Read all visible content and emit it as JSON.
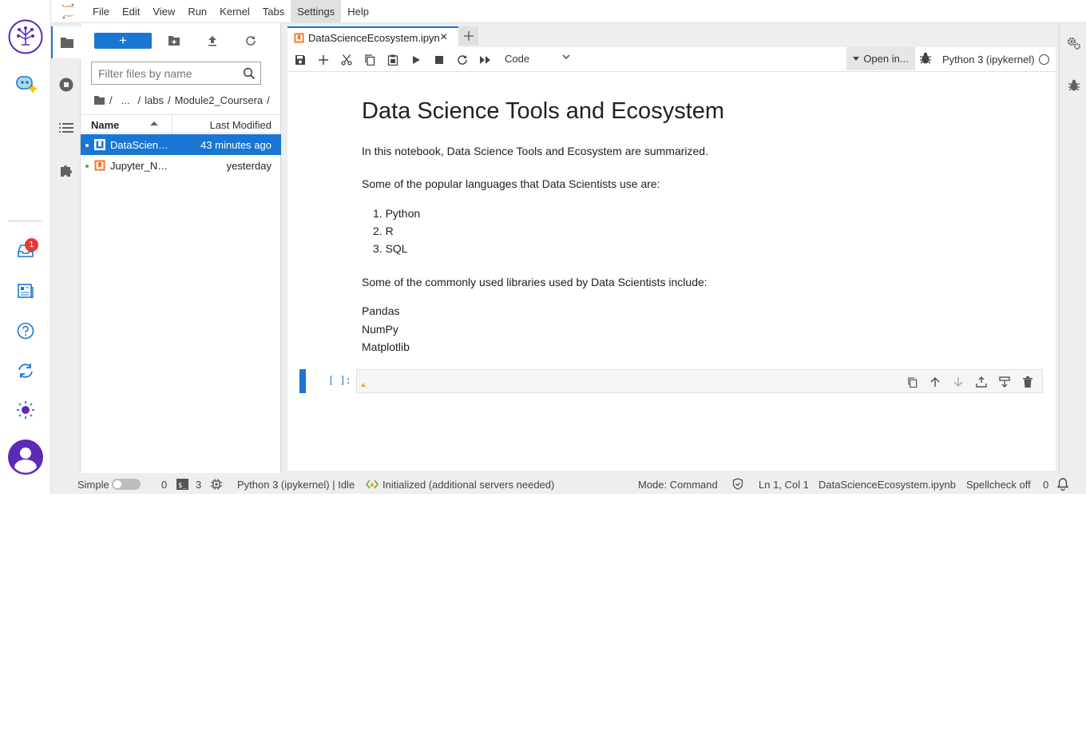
{
  "menubar": {
    "items": [
      "File",
      "Edit",
      "View",
      "Run",
      "Kernel",
      "Tabs",
      "Settings",
      "Help"
    ],
    "active": "Settings"
  },
  "outer_rail": {
    "notification_count": "1",
    "icons": [
      "app-logo-icon",
      "ai-assistant-icon",
      "inbox-icon",
      "document-icon",
      "help-icon",
      "sync-icon",
      "theme-icon",
      "user-avatar-icon"
    ]
  },
  "filebrowser": {
    "filter_placeholder": "Filter files by name",
    "breadcrumb": [
      "/",
      "...",
      "/",
      "labs",
      "/",
      "Module2_Coursera",
      "/"
    ],
    "header": {
      "name": "Name",
      "modified": "Last Modified"
    },
    "files": [
      {
        "name": "DataScienceEcosystem.ipynb",
        "modified": "43 minutes ago",
        "selected": true
      },
      {
        "name": "Jupyter_Notebook.ipynb",
        "modified": "yesterday",
        "selected": false
      }
    ]
  },
  "tab": {
    "label": "DataScienceEcosystem.ipynb",
    "add": "+"
  },
  "toolbar": {
    "cell_type": "Code",
    "open_in": "Open in...",
    "kernel": "Python 3 (ipykernel)"
  },
  "notebook": {
    "title": "Data Science Tools and Ecosystem",
    "intro": "In this notebook, Data Science Tools and Ecosystem are summarized.",
    "languages_intro": "Some of the popular languages that Data Scientists use are:",
    "languages": [
      "1. Python",
      "2. R",
      "3. SQL"
    ],
    "libraries_intro": "Some of the commonly used libraries used by Data Scientists include:",
    "libraries": [
      "Pandas",
      "NumPy",
      "Matplotlib"
    ],
    "prompt": "[ ]:"
  },
  "statusbar": {
    "simple": "Simple",
    "count_a": "0",
    "terminals": "3",
    "kernel_status": "Python 3 (ipykernel) | Idle",
    "lsp": "Initialized (additional servers needed)",
    "mode": "Mode: Command",
    "position": "Ln 1, Col 1",
    "file": "DataScienceEcosystem.ipynb",
    "spellcheck": "Spellcheck off",
    "notifications": "0"
  },
  "colors": {
    "accent": "#1976d2",
    "notebook_icon": "#f37726",
    "badge": "#e53935",
    "theme_icon": "#5b2bb5"
  }
}
